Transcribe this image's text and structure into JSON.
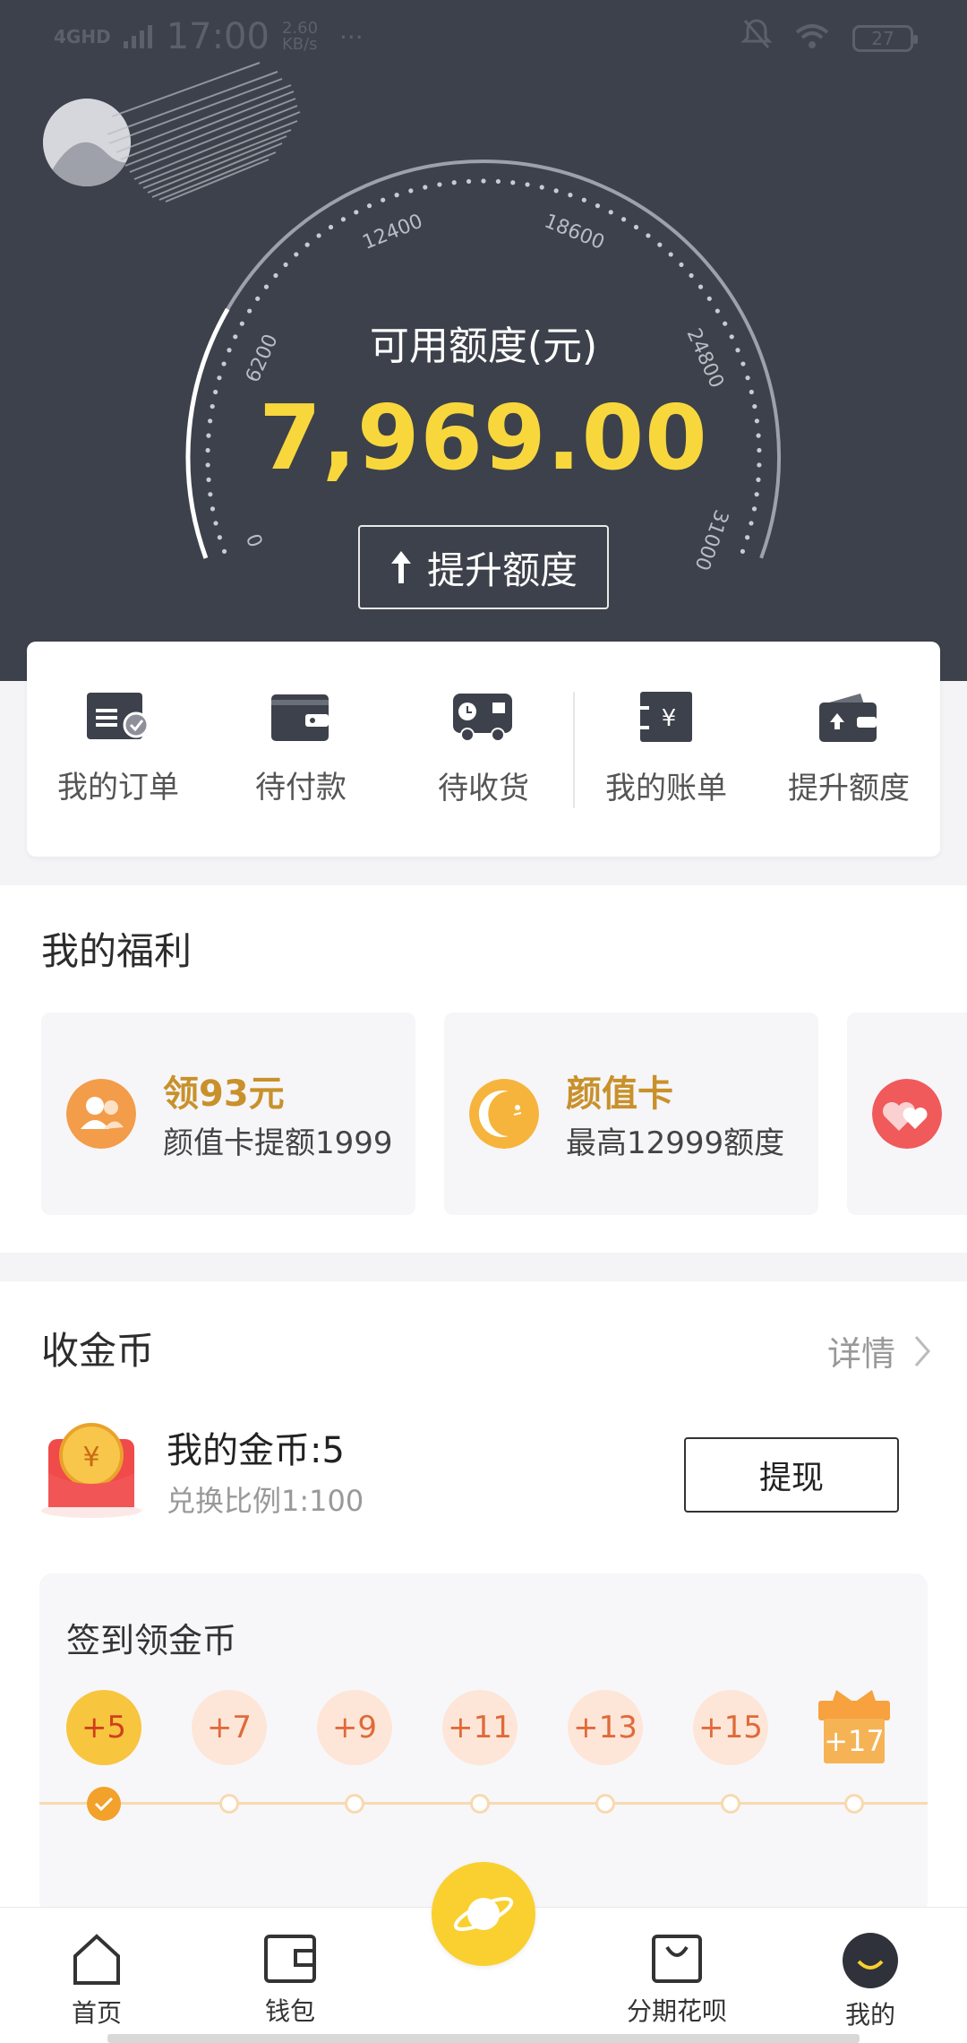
{
  "status_bar": {
    "network": "4GHD",
    "time": "17:00",
    "speed": "2.60 KB/s",
    "more": "···",
    "battery": "27"
  },
  "gauge": {
    "title": "可用额度(元)",
    "value": "7,969.00",
    "ticks": [
      "0",
      "6200",
      "12400",
      "18600",
      "24800",
      "31000"
    ],
    "raise_button": "提升额度"
  },
  "quick_menu": [
    {
      "label": "我的订单",
      "icon": "order-icon"
    },
    {
      "label": "待付款",
      "icon": "wallet-icon"
    },
    {
      "label": "待收货",
      "icon": "truck-icon"
    },
    {
      "label": "我的账单",
      "icon": "bill-icon"
    },
    {
      "label": "提升额度",
      "icon": "raise-wallet-icon"
    }
  ],
  "welfare": {
    "title": "我的福利",
    "cards": [
      {
        "title": "领93元",
        "subtitle": "颜值卡提额1999",
        "icon": "people-icon",
        "color": "#f39c4a"
      },
      {
        "title": "颜值卡",
        "subtitle": "最高12999额度",
        "icon": "moon-icon",
        "color": "#f6b43c"
      },
      {
        "title": "",
        "subtitle": "",
        "icon": "hearts-icon",
        "color": "#f05a5a"
      }
    ]
  },
  "coins": {
    "title": "收金币",
    "detail": "详情",
    "my_coins": "我的金币:5",
    "rate": "兑换比例1:100",
    "withdraw": "提现",
    "signin_title": "签到领金币",
    "days": [
      "+5",
      "+7",
      "+9",
      "+11",
      "+13",
      "+15",
      "+17"
    ],
    "checked_days": 1
  },
  "bottom_nav": [
    {
      "label": "首页",
      "icon": "home-icon"
    },
    {
      "label": "钱包",
      "icon": "wallet-icon"
    },
    {
      "label": "",
      "icon": "planet-icon"
    },
    {
      "label": "分期花呗",
      "icon": "shopping-bag-icon"
    },
    {
      "label": "我的",
      "icon": "smile-icon"
    }
  ],
  "colors": {
    "header_bg": "#3d414b",
    "accent_yellow": "#f8d73d",
    "gold_text": "#c9912b"
  }
}
